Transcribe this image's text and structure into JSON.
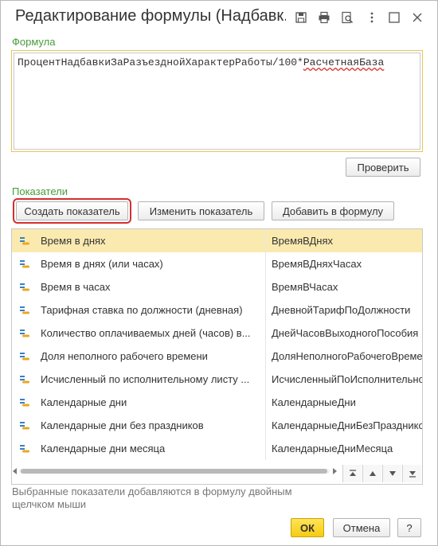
{
  "window": {
    "title": "Редактирование формулы (Надбавк..."
  },
  "formula": {
    "label": "Формула",
    "text_part1": "ПроцентНадбавкиЗаРазъезднойХарактерРаботы/100*",
    "text_part2": "РасчетнаяБаза",
    "check_button": "Проверить"
  },
  "indicators": {
    "label": "Показатели",
    "create_button": "Создать показатель",
    "edit_button": "Изменить показатель",
    "add_button": "Добавить в формулу",
    "rows": [
      {
        "name": "Время в днях",
        "id": "ВремяВДнях"
      },
      {
        "name": "Время в днях (или часах)",
        "id": "ВремяВДняхЧасах"
      },
      {
        "name": "Время в часах",
        "id": "ВремяВЧасах"
      },
      {
        "name": "Тарифная ставка по должности (дневная)",
        "id": "ДневнойТарифПоДолжности"
      },
      {
        "name": "Количество оплачиваемых дней (часов) в...",
        "id": "ДнейЧасовВыходногоПособия"
      },
      {
        "name": "Доля неполного рабочего времени",
        "id": "ДоляНеполногоРабочегоВремени"
      },
      {
        "name": "Исчисленный по исполнительному листу ...",
        "id": "ИсчисленныйПоИсполнительномуЛисту"
      },
      {
        "name": "Календарные дни",
        "id": "КалендарныеДни"
      },
      {
        "name": "Календарные дни без праздников",
        "id": "КалендарныеДниБезПраздников"
      },
      {
        "name": "Календарные дни месяца",
        "id": "КалендарныеДниМесяца"
      }
    ],
    "selected_index": 0
  },
  "hint": "Выбранные показатели добавляются в формулу двойным щелчком мыши",
  "footer": {
    "ok_button": "ОК",
    "cancel_button": "Отмена",
    "help_button": "?"
  },
  "colors": {
    "accent_green": "#4a9a3a",
    "selection": "#fbeab0",
    "primary_yellow": "#f5cc12",
    "focus_red": "#d32f2f"
  }
}
